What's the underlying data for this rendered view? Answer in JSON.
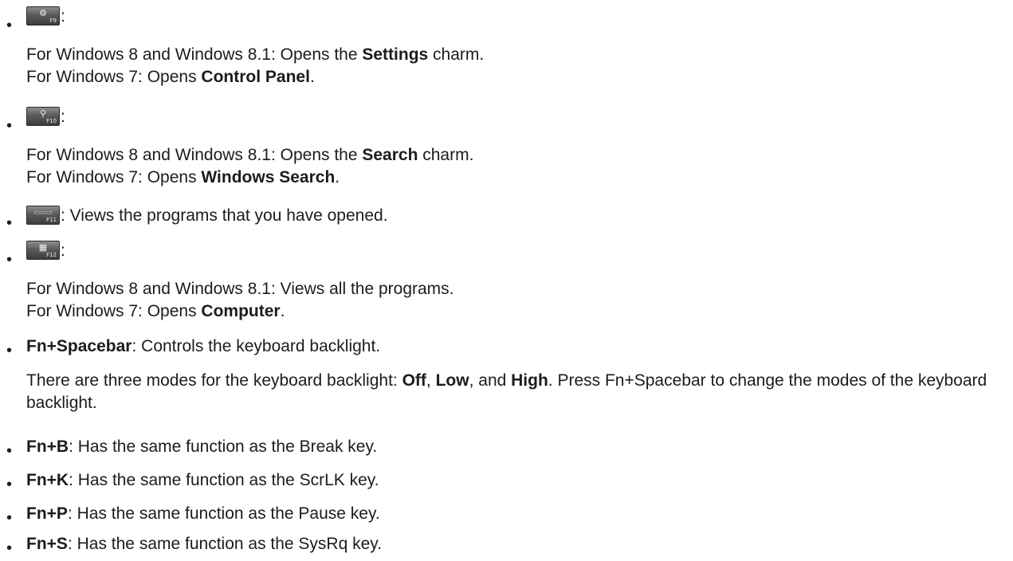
{
  "items": [
    {
      "key": {
        "icon": "gear-icon",
        "glyph": "⚙",
        "fn": "F9"
      },
      "colon": ":",
      "lines": [
        {
          "pre": "For Windows 8 and Windows 8.1: Opens the ",
          "bold": "Settings",
          "post": " charm."
        },
        {
          "pre": "For Windows 7: Opens ",
          "bold": "Control Panel",
          "post": "."
        }
      ]
    },
    {
      "key": {
        "icon": "search-icon",
        "glyph": "⚲",
        "fn": "F10"
      },
      "colon": ":",
      "lines": [
        {
          "pre": "For Windows 8 and Windows 8.1: Opens the ",
          "bold": "Search",
          "post": " charm."
        },
        {
          "pre": "For Windows 7: Opens ",
          "bold": "Windows Search",
          "post": "."
        }
      ]
    },
    {
      "key": {
        "icon": "open-programs-icon",
        "glyph": "▭▭▭",
        "fn": "F11"
      },
      "inline": ": Views the programs that you have opened."
    },
    {
      "key": {
        "icon": "all-programs-icon",
        "glyph": "▦",
        "fn": "F12"
      },
      "colon": ":",
      "lines": [
        {
          "pre": "For Windows 8 and Windows 8.1: Views all the programs.",
          "bold": "",
          "post": ""
        },
        {
          "pre": "For Windows 7: Opens ",
          "bold": "Computer",
          "post": "."
        }
      ]
    }
  ],
  "spacebar": {
    "key": "Fn+Spacebar",
    "desc": ": Controls the keyboard backlight.",
    "para_pre": "There are three modes for the keyboard backlight: ",
    "mode1": "Off",
    "sep1": ", ",
    "mode2": "Low",
    "sep2": ", and ",
    "mode3": "High",
    "para_post": ". Press Fn+Spacebar to change the modes of the keyboard backlight."
  },
  "shortcuts": [
    {
      "key": "Fn+B",
      "desc": ": Has the same function as the Break key."
    },
    {
      "key": "Fn+K",
      "desc": ": Has the same function as the ScrLK key."
    },
    {
      "key": "Fn+P",
      "desc": ": Has the same function as the Pause key."
    },
    {
      "key": "Fn+S",
      "desc": ": Has the same function as the SysRq key."
    }
  ]
}
